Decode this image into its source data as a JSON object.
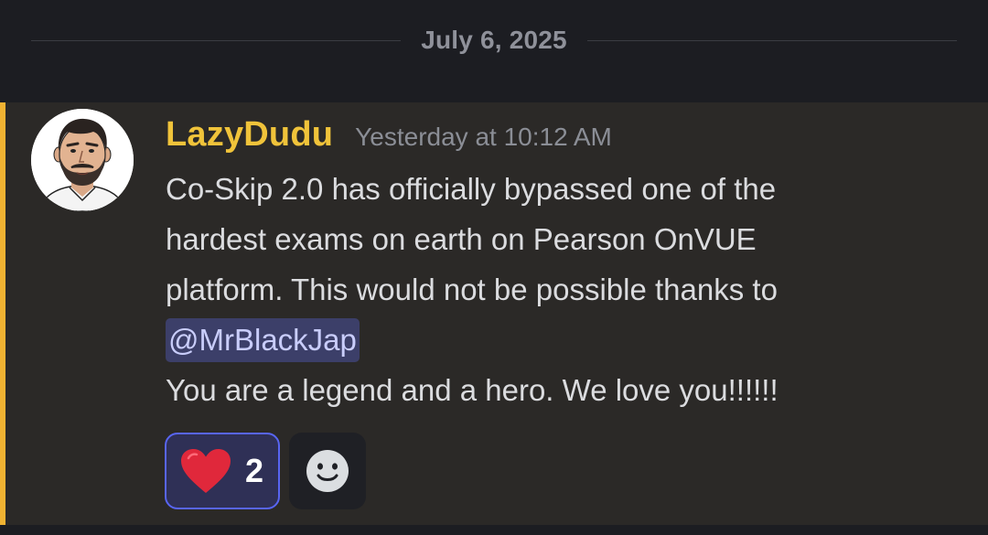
{
  "date_divider": {
    "label": "July 6, 2025"
  },
  "message": {
    "username": "LazyDudu",
    "timestamp": "Yesterday at 10:12 AM",
    "lines": [
      "Co-Skip 2.0 has officially bypassed one of the",
      "hardest exams on earth on Pearson OnVUE",
      "platform. This would not be possible thanks to"
    ],
    "mention": "@MrBlackJap",
    "last_line": "You are a legend and a hero. We love you!!!!!!"
  },
  "reactions": [
    {
      "icon": "heart-icon",
      "count": "2"
    }
  ],
  "add_reaction": {
    "icon": "smiley-add-reaction-icon"
  },
  "colors": {
    "username": "#f0c33a",
    "highlight_bar": "#f0b232",
    "mention_bg": "#3c3f69",
    "reaction_border": "#5865f2",
    "heart": "#e0283b",
    "message_bg": "#2b2927",
    "page_bg": "#1c1d22"
  }
}
